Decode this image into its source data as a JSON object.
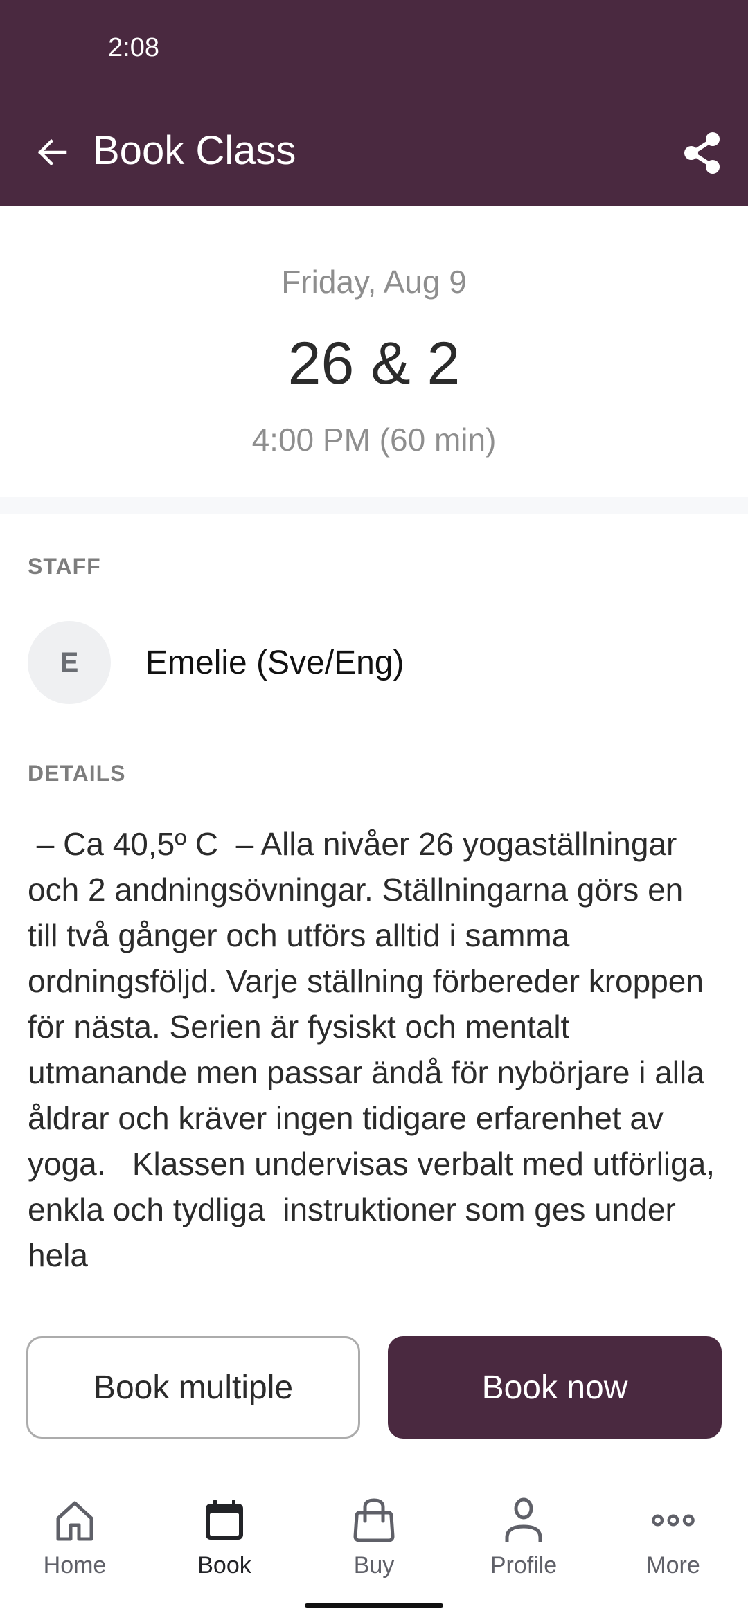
{
  "status_bar": {
    "time": "2:08"
  },
  "app_bar": {
    "title": "Book Class",
    "back_icon": "arrow-left-icon",
    "share_icon": "share-icon",
    "background_color": "#4a2940"
  },
  "class_info": {
    "date": "Friday, Aug 9",
    "name": "26 & 2",
    "time": "4:00 PM (60 min)"
  },
  "staff": {
    "section_label": "STAFF",
    "avatar_initial": "E",
    "name": "Emelie (Sve/Eng)"
  },
  "details": {
    "section_label": "DETAILS",
    "text": " – Ca 40,5º C  – Alla nivåer 26 yogaställningar och 2 andningsövningar. Ställningarna görs en till två gånger och utförs alltid i samma ordningsföljd. Varje ställning förbereder kroppen för nästa. Serien är fysiskt och mentalt utmanande men passar ändå för nybörjare i alla åldrar och kräver ingen tidigare erfarenhet av yoga.   Klassen undervisas verbalt med utförliga, enkla och tydliga  instruktioner som ges under hela"
  },
  "actions": {
    "book_multiple_label": "Book multiple",
    "book_now_label": "Book now",
    "primary_color": "#4a2940"
  },
  "bottom_nav": {
    "items": [
      {
        "label": "Home",
        "icon": "home-icon",
        "active": false
      },
      {
        "label": "Book",
        "icon": "calendar-icon",
        "active": true
      },
      {
        "label": "Buy",
        "icon": "shopping-bag-icon",
        "active": false
      },
      {
        "label": "Profile",
        "icon": "person-icon",
        "active": false
      },
      {
        "label": "More",
        "icon": "more-horizontal-icon",
        "active": false
      }
    ]
  }
}
